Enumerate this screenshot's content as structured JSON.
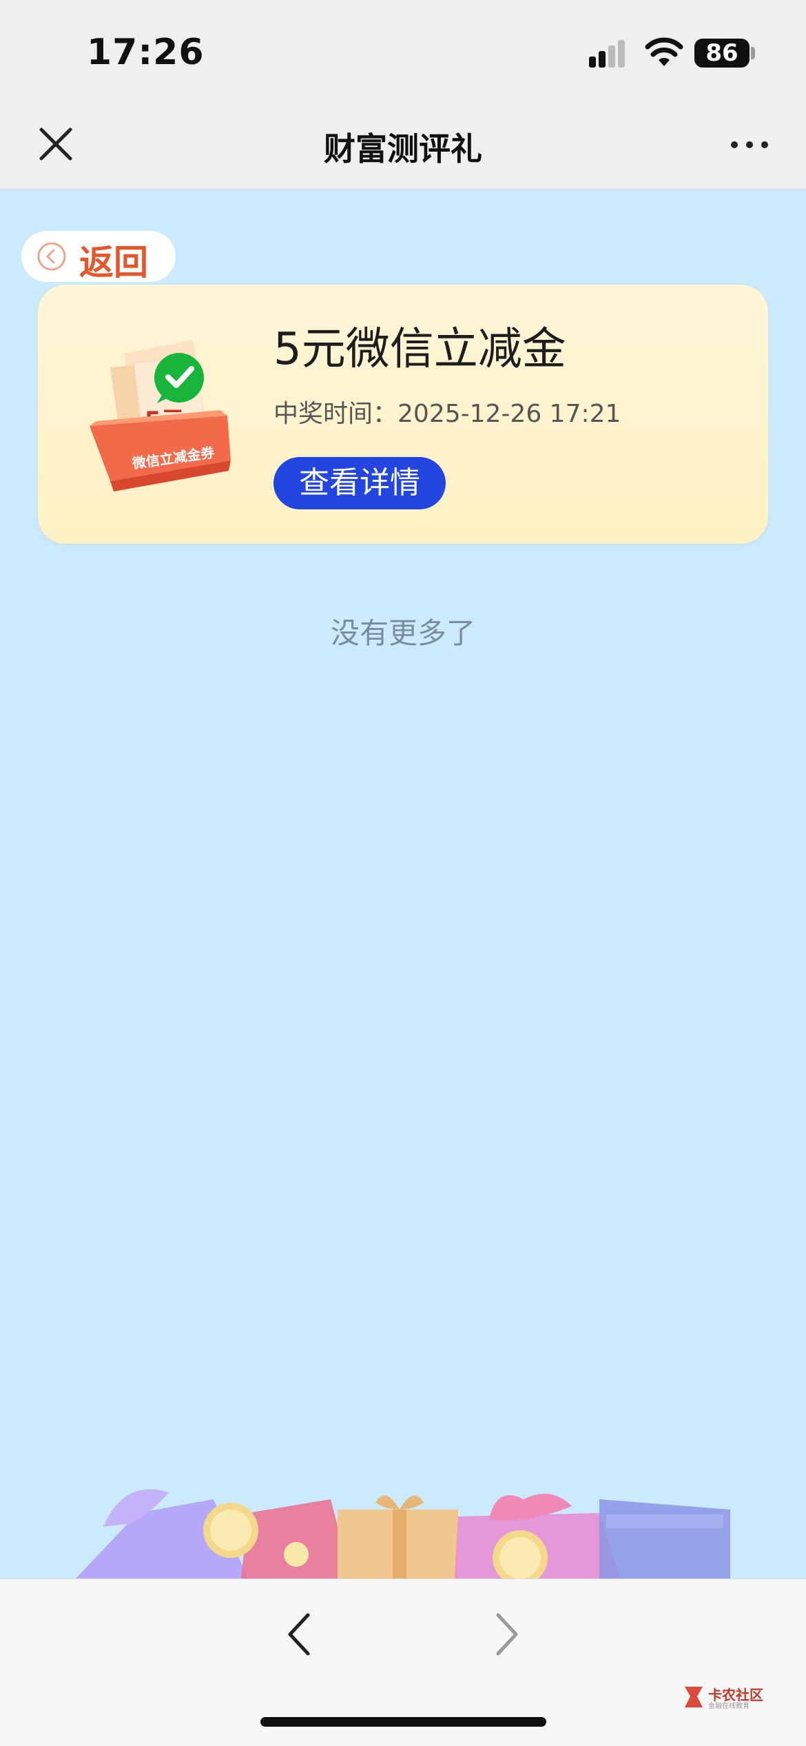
{
  "status_bar": {
    "time": "17:26",
    "battery": "86"
  },
  "nav": {
    "title": "财富测评礼"
  },
  "back": {
    "label": "返回"
  },
  "prize_card": {
    "title": "5元微信立减金",
    "time_label": "中奖时间：",
    "time_value": "2025-12-26 17:21",
    "detail_button": "查看详情",
    "illustration": {
      "amount": "5元",
      "coupon_text": "微信立减金券"
    }
  },
  "no_more": "没有更多了",
  "watermark": {
    "name": "卡农社区",
    "sub": "金融在线教育"
  },
  "colors": {
    "accent_blue": "#2346e0",
    "back_orange": "#e4562c",
    "background": "#cbebfc",
    "card_bg": "#fff3cc"
  }
}
